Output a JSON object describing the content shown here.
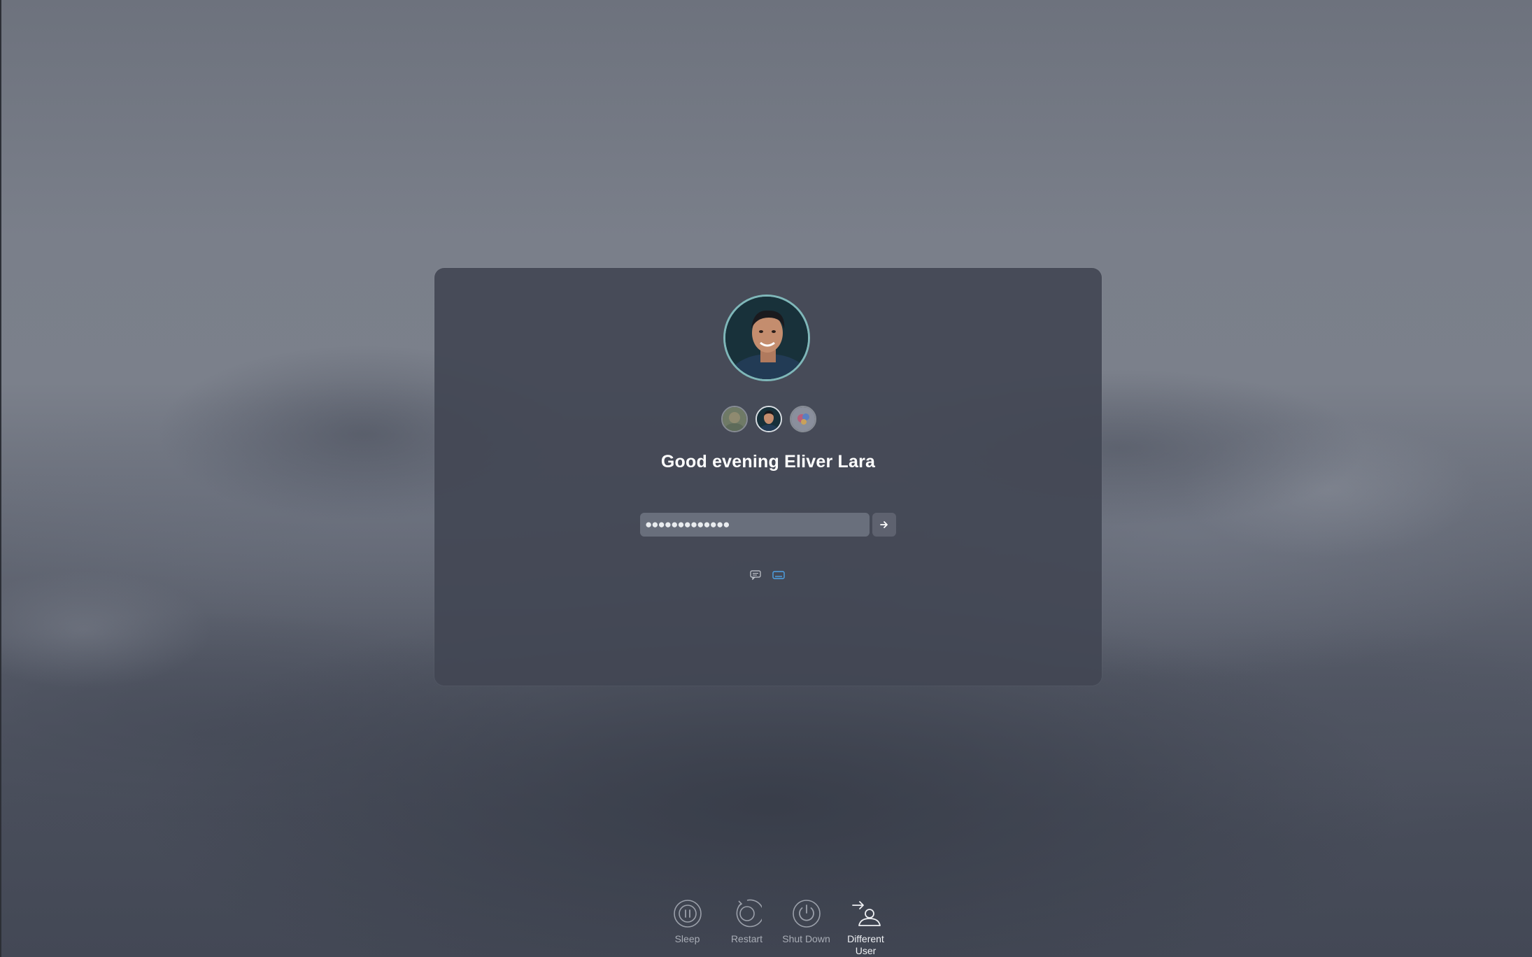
{
  "login": {
    "greeting": "Good evening Eliver Lara",
    "password_mask": "●●●●●●●●●●●●●",
    "submit_icon": "arrow-right-icon",
    "users": [
      {
        "icon": "user-avatar-1",
        "active": false
      },
      {
        "icon": "user-avatar-eliver",
        "active": true
      },
      {
        "icon": "user-avatar-3",
        "active": false
      }
    ],
    "input_icons": [
      "caption-icon",
      "keyboard-icon"
    ]
  },
  "power_actions": [
    {
      "label": "Sleep",
      "icon": "sleep-icon"
    },
    {
      "label": "Restart",
      "icon": "restart-icon"
    },
    {
      "label": "Shut Down",
      "icon": "shutdown-icon"
    },
    {
      "label": "Different User",
      "icon": "different-user-icon"
    }
  ],
  "colors": {
    "panel": "#424654",
    "avatar_ring": "#7fb7b9",
    "keyboard_icon": "#4ea3e6"
  }
}
